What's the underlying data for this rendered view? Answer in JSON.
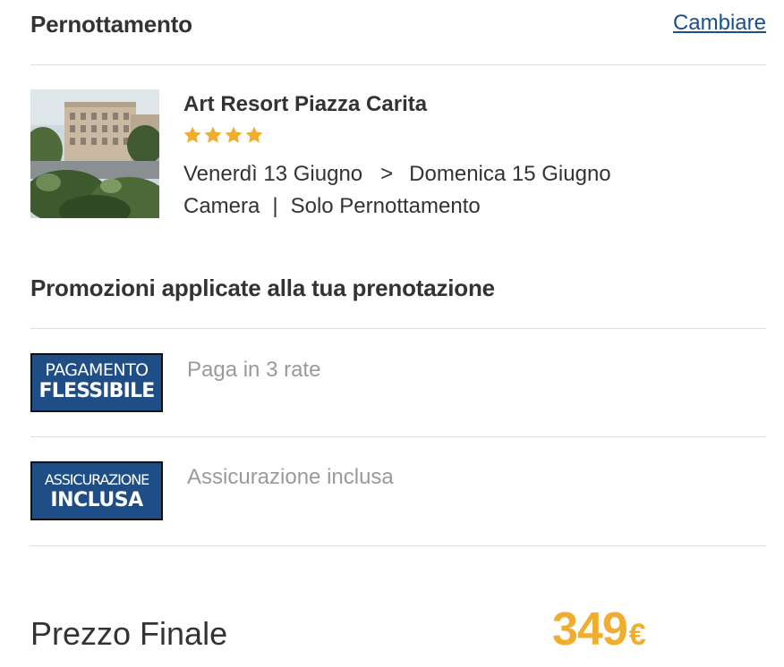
{
  "section": {
    "title": "Pernottamento",
    "change_link": "Cambiare"
  },
  "hotel": {
    "name": "Art Resort Piazza Carita",
    "stars": 4,
    "checkin": "Venerdì 13 Giugno",
    "arrow": ">",
    "checkout": "Domenica 15 Giugno",
    "room": "Camera",
    "separator": "|",
    "board": "Solo Pernottamento"
  },
  "promotions": {
    "title": "Promozioni applicate alla tua prenotazione",
    "items": [
      {
        "badge_line1": "PAGAMENTO",
        "badge_line2": "FLESSIBILE",
        "text": "Paga in 3 rate"
      },
      {
        "badge_line1": "ASSICURAZIONE",
        "badge_line2": "INCLUSA",
        "text": "Assicurazione inclusa"
      }
    ]
  },
  "final": {
    "label": "Prezzo Finale",
    "price": "349",
    "currency": "€"
  },
  "colors": {
    "link": "#1a4f8b",
    "star": "#f0ad2e",
    "price": "#f0ad2e",
    "badge_bg": "#1f4e86",
    "muted_text": "#9a9a9a"
  },
  "icons": {
    "star": "star-icon",
    "hotel_photo": "hotel-photo"
  }
}
